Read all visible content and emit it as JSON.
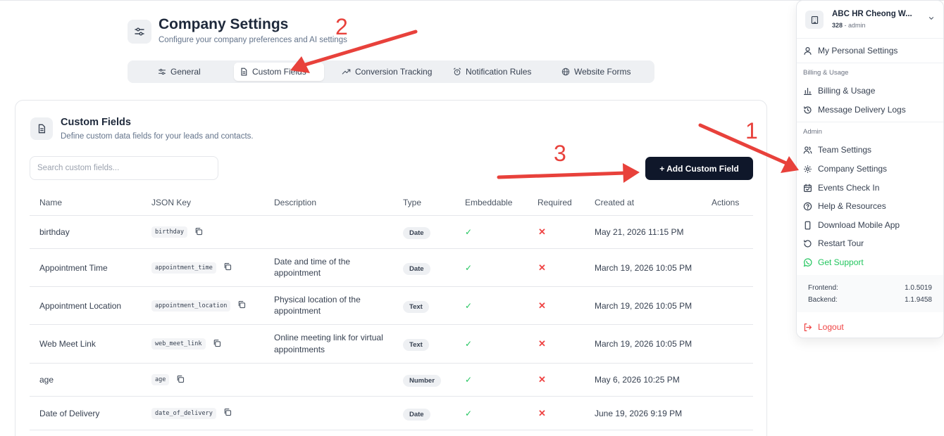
{
  "header": {
    "title": "Company Settings",
    "subtitle": "Configure your company preferences and AI settings"
  },
  "tabs": [
    {
      "label": "General",
      "icon": "sliders-icon"
    },
    {
      "label": "Custom Fields",
      "icon": "file-text-icon",
      "active": true
    },
    {
      "label": "Conversion Tracking",
      "icon": "trend-up-icon"
    },
    {
      "label": "Notification Rules",
      "icon": "alarm-icon"
    },
    {
      "label": "Website Forms",
      "icon": "globe-icon"
    }
  ],
  "card": {
    "title": "Custom Fields",
    "subtitle": "Define custom data fields for your leads and contacts.",
    "search_placeholder": "Search custom fields...",
    "add_button": "+ Add Custom Field"
  },
  "table": {
    "columns": [
      "Name",
      "JSON Key",
      "Description",
      "Type",
      "Embeddable",
      "Required",
      "Created at",
      "Actions"
    ],
    "rows": [
      {
        "name": "birthday",
        "key": "birthday",
        "description": "",
        "type": "Date",
        "embeddable": "✓",
        "required": "✕",
        "created": "May 21, 2026 11:15 PM"
      },
      {
        "name": "Appointment Time",
        "key": "appointment_time",
        "description": "Date and time of the appointment",
        "type": "Date",
        "embeddable": "✓",
        "required": "✕",
        "created": "March 19, 2026 10:05 PM"
      },
      {
        "name": "Appointment Location",
        "key": "appointment_location",
        "description": "Physical location of the appointment",
        "type": "Text",
        "embeddable": "✓",
        "required": "✕",
        "created": "March 19, 2026 10:05 PM"
      },
      {
        "name": "Web Meet Link",
        "key": "web_meet_link",
        "description": "Online meeting link for virtual appointments",
        "type": "Text",
        "embeddable": "✓",
        "required": "✕",
        "created": "March 19, 2026 10:05 PM"
      },
      {
        "name": "age",
        "key": "age",
        "description": "",
        "type": "Number",
        "embeddable": "✓",
        "required": "✕",
        "created": "May 6, 2026 10:25 PM"
      },
      {
        "name": "Date of Delivery",
        "key": "date_of_delivery",
        "description": "",
        "type": "Date",
        "embeddable": "✓",
        "required": "✕",
        "created": "June 19, 2026 9:19 PM"
      }
    ]
  },
  "menu": {
    "org_name": "ABC HR Cheong W...",
    "org_id": "328",
    "org_role": " - admin",
    "personal": "My Personal Settings",
    "billing_section": "Billing & Usage",
    "billing": "Billing & Usage",
    "delivery_logs": "Message Delivery Logs",
    "admin_section": "Admin",
    "team": "Team Settings",
    "company": "Company Settings",
    "events": "Events Check In",
    "help": "Help & Resources",
    "download": "Download Mobile App",
    "restart": "Restart Tour",
    "support": "Get Support",
    "frontend_label": "Frontend:",
    "frontend_version": "1.0.5019",
    "backend_label": "Backend:",
    "backend_version": "1.1.9458",
    "logout": "Logout"
  },
  "annotations": {
    "one": "1",
    "two": "2",
    "three": "3",
    "color": "#e8413b"
  }
}
